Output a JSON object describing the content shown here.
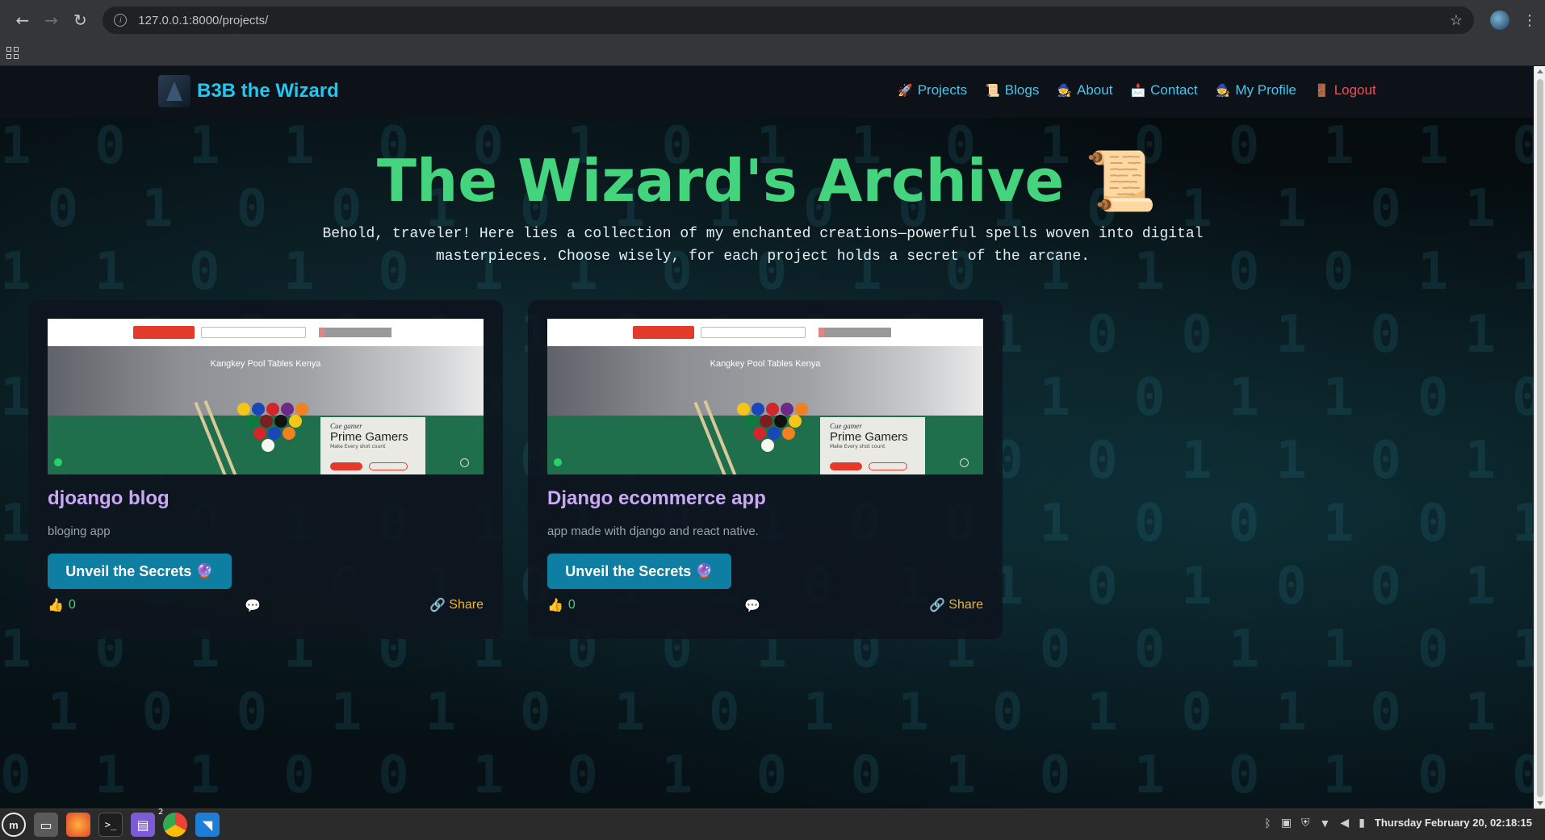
{
  "browser": {
    "url": "127.0.0.1:8000/projects/",
    "back_icon": "←",
    "forward_icon": "→",
    "reload_icon": "↻",
    "star_icon": "☆",
    "menu_icon": "⋮"
  },
  "site": {
    "brand": "B3B the Wizard",
    "nav": [
      {
        "icon": "🚀",
        "label": "Projects"
      },
      {
        "icon": "📜",
        "label": "Blogs"
      },
      {
        "icon": "🧙",
        "label": "About"
      },
      {
        "icon": "📩",
        "label": "Contact"
      },
      {
        "icon": "🧙",
        "label": "My Profile"
      },
      {
        "icon": "🚪",
        "label": "Logout"
      }
    ]
  },
  "hero": {
    "title": "The Wizard's Archive 📜",
    "subtitle": "Behold, traveler! Here lies a collection of my enchanted creations—powerful spells woven into digital masterpieces. Choose wisely, for each project holds a secret of the arcane."
  },
  "projects": [
    {
      "image_caption": "Kangkey Pool Tables Kenya",
      "promo_small": "Cue gamer",
      "promo_title": "Prime Gamers",
      "promo_tag": "Make Every shot count",
      "title": "djoango blog",
      "description": "bloging app",
      "button": "Unveil the Secrets 🔮",
      "likes": "0",
      "like_icon": "👍",
      "comment_icon": "💬",
      "share": "Share",
      "share_icon": "🔗"
    },
    {
      "image_caption": "Kangkey Pool Tables Kenya",
      "promo_small": "Cue gamer",
      "promo_title": "Prime Gamers",
      "promo_tag": "Make Every shot count",
      "title": "Django ecommerce app",
      "description": "app made with django and react native.",
      "button": "Unveil the Secrets 🔮",
      "likes": "0",
      "like_icon": "👍",
      "comment_icon": "💬",
      "share": "Share",
      "share_icon": "🔗"
    }
  ],
  "taskbar": {
    "clock": "Thursday February 20, 02:18:15",
    "chrome_badge": "2"
  },
  "colors": {
    "brand": "#22c6ee",
    "hero_title": "#44d47e",
    "card_title": "#c9a9f5",
    "button": "#0e7ea3",
    "logout": "#e8505b"
  }
}
